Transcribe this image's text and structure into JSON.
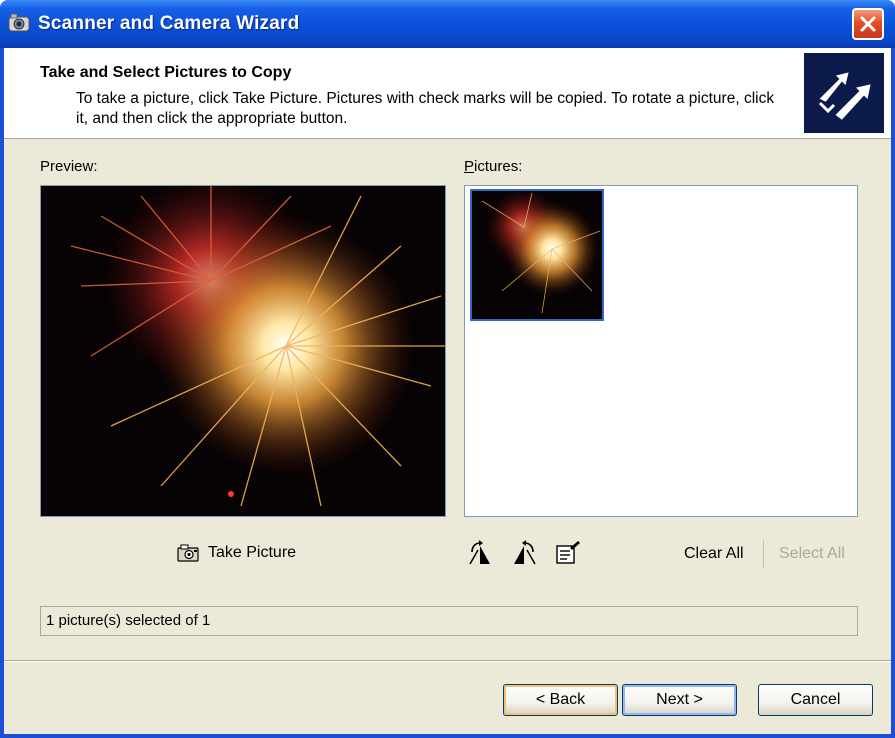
{
  "window": {
    "title": "Scanner and Camera Wizard",
    "title_icon": "camera-scanner-icon",
    "close_icon": "close-icon"
  },
  "header": {
    "title": "Take and Select Pictures to Copy",
    "description": "To take a picture, click Take Picture. Pictures with check marks will be copied. To rotate a picture, click it, and then click the appropriate button.",
    "icon": "wizard-arrows-icon"
  },
  "preview": {
    "label": "Preview:"
  },
  "pictures": {
    "label_mnemonic": "P",
    "label_rest": "ictures:",
    "items": [
      {
        "name": "fireworks",
        "selected": true
      }
    ]
  },
  "toolbar": {
    "take_picture_label": "Take Picture",
    "rotate_right_icon": "rotate-clockwise-icon",
    "rotate_left_icon": "rotate-counterclockwise-icon",
    "properties_icon": "properties-icon",
    "clear_all_label": "Clear All",
    "select_all_label": "Select All"
  },
  "status": {
    "text": "1 picture(s) selected of 1"
  },
  "buttons": {
    "back_label": "< Back",
    "next_label": "Next >",
    "cancel_label": "Cancel"
  },
  "colors": {
    "titlebar": "#0a46c8",
    "dialog_bg": "#ece9d8",
    "selection": "#316ac5",
    "close_button": "#e0502c"
  }
}
